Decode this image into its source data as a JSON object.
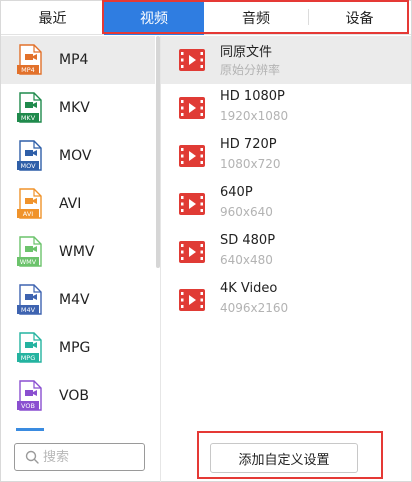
{
  "tabs": [
    {
      "label": "最近"
    },
    {
      "label": "视频"
    },
    {
      "label": "音频"
    },
    {
      "label": "设备"
    }
  ],
  "active_tab": "视频",
  "formats": [
    {
      "label": "MP4",
      "badge": "MP4",
      "color": "#e2712b"
    },
    {
      "label": "MKV",
      "badge": "MKV",
      "color": "#1f8a4c"
    },
    {
      "label": "MOV",
      "badge": "MOV",
      "color": "#2f5fa8"
    },
    {
      "label": "AVI",
      "badge": "AVI",
      "color": "#f0932b"
    },
    {
      "label": "WMV",
      "badge": "WMV",
      "color": "#6cc36c"
    },
    {
      "label": "M4V",
      "badge": "M4V",
      "color": "#3e63b0"
    },
    {
      "label": "MPG",
      "badge": "MPG",
      "color": "#24b3a0"
    },
    {
      "label": "VOB",
      "badge": "VOB",
      "color": "#8a4fd0"
    }
  ],
  "selected_format": "MP4",
  "presets": [
    {
      "name": "同原文件",
      "resolution": "原始分辨率"
    },
    {
      "name": "HD 1080P",
      "resolution": "1920x1080"
    },
    {
      "name": "HD 720P",
      "resolution": "1080x720"
    },
    {
      "name": "640P",
      "resolution": "960x640"
    },
    {
      "name": "SD 480P",
      "resolution": "640x480"
    },
    {
      "name": "4K Video",
      "resolution": "4096x2160"
    }
  ],
  "search": {
    "placeholder": "搜索",
    "value": ""
  },
  "custom_button_label": "添加自定义设置",
  "colors": {
    "accent": "#2f7de1",
    "highlight": "#e53935",
    "video_icon": "#e03b35",
    "selected_bg": "#ebebeb"
  }
}
